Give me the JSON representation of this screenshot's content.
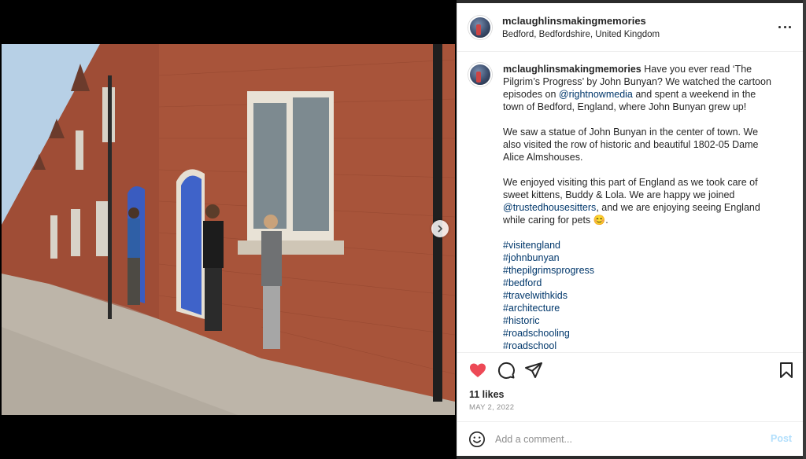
{
  "post": {
    "username": "mclaughlinsmakingmemories",
    "location": "Bedford, Bedfordshire, United Kingdom"
  },
  "caption": {
    "username": "mclaughlinsmakingmemories",
    "p1_before": " Have you ever read ‘The Pilgrim’s Progress’ by John Bunyan? We watched the cartoon episodes on ",
    "p1_mention": "@rightnowmedia",
    "p1_after": " and spent a weekend in the town of Bedford, England, where John Bunyan grew up!",
    "p2": "We saw a statue of John Bunyan in the center of town. We also visited the row of historic and beautiful 1802-05 Dame Alice Almshouses.",
    "p3_before": "We enjoyed visiting this part of England as we took care of sweet kittens, Buddy & Lola. We are happy we joined ",
    "p3_mention": "@trustedhousesitters",
    "p3_after": ", and we are enjoying seeing England while caring for pets 😊.",
    "hashtags": [
      "#visitengland",
      "#johnbunyan",
      "#thepilgrimsprogress",
      "#bedford",
      "#travelwithkids",
      "#architecture",
      "#historic",
      "#roadschooling",
      "#roadschool"
    ]
  },
  "stats": {
    "likes": "11 likes",
    "date": "MAY 2, 2022"
  },
  "comment": {
    "placeholder": "Add a comment...",
    "post_label": "Post"
  },
  "icons": {
    "like": "heart-filled-icon",
    "comment": "comment-bubble-icon",
    "share": "paper-plane-icon",
    "save": "bookmark-icon",
    "more": "more-horizontal-icon",
    "emoji": "emoji-smile-icon",
    "next": "chevron-right-icon"
  },
  "colors": {
    "like_red": "#ed4956",
    "link_blue": "#00376b",
    "post_disabled": "#b2dffc",
    "muted": "#8e8e8e"
  },
  "carousel": {
    "count": 6,
    "active": 1
  }
}
